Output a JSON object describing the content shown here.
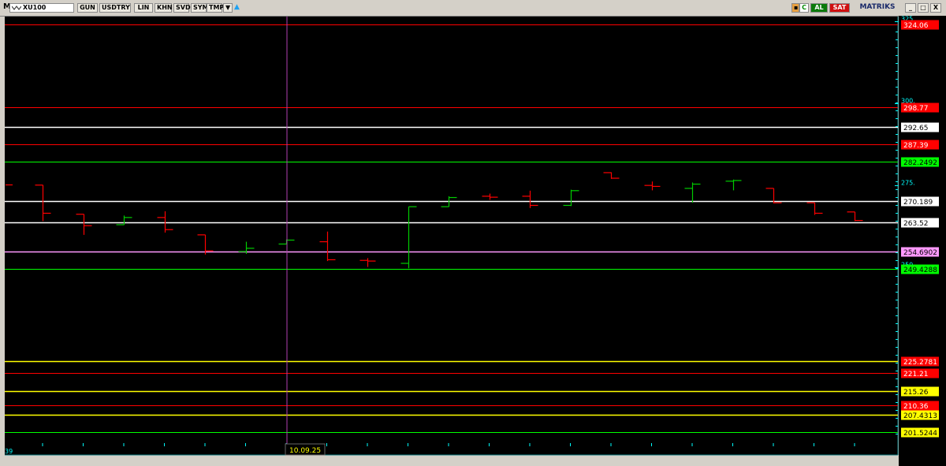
{
  "toolbar": {
    "app_icon": "M",
    "symbol": "XU100",
    "buttons": [
      "GUN",
      "USDTRY",
      "LIN",
      "KHN",
      "SVD",
      "SYM",
      "TMP"
    ],
    "dropdown_icon": "▼",
    "twitter_icon": "twitter-bird-icon",
    "tool_c": "C",
    "al_label": "AL",
    "sat_label": "SAT",
    "brand": "MATRIKS",
    "min": "_",
    "max": "□",
    "close": "X"
  },
  "colors": {
    "background": "#000000",
    "up": "#00cc00",
    "down": "#ff0000",
    "white_line": "#ffffff",
    "pink_line": "#ff99ff",
    "yellow_line": "#ffff00",
    "axis_text": "#00ffff"
  },
  "chart_data": {
    "type": "ohlc",
    "instrument": "XU100",
    "x_label_start": "39",
    "crosshair_date": "10.09.25",
    "ylim_display": [
      200,
      326
    ],
    "break_between": [
      227,
      247
    ],
    "axis_ticks": [
      "325.",
      "300.",
      "275.",
      "250"
    ],
    "horizontal_levels": [
      {
        "label": "324.06",
        "value": 324.06,
        "color": "#ff0000",
        "tag_bg": "#ff0000",
        "tag_fg": "#ffffff"
      },
      {
        "label": "298.77",
        "value": 298.77,
        "color": "#ff0000",
        "tag_bg": "#ff0000",
        "tag_fg": "#ffffff"
      },
      {
        "label": "292.65",
        "value": 292.65,
        "color": "#ffffff",
        "tag_bg": "#ffffff",
        "tag_fg": "#000000"
      },
      {
        "label": "287.39",
        "value": 287.39,
        "color": "#ff0000",
        "tag_bg": "#ff0000",
        "tag_fg": "#ffffff"
      },
      {
        "label": "282.2492",
        "value": 282.2492,
        "color": "#00ff00",
        "tag_bg": "#00ff00",
        "tag_fg": "#000000"
      },
      {
        "label": "270.189",
        "value": 270.189,
        "color": "#ffffff",
        "tag_bg": "#ffffff",
        "tag_fg": "#000000"
      },
      {
        "label": "263.52",
        "value": 263.52,
        "color": "#ffffff",
        "tag_bg": "#ffffff",
        "tag_fg": "#000000"
      },
      {
        "label": "254.6902",
        "value": 254.6902,
        "color": "#ff99ff",
        "tag_bg": "#ff99ff",
        "tag_fg": "#000000"
      },
      {
        "label": "249.4288",
        "value": 249.4288,
        "color": "#00ff00",
        "tag_bg": "#00ff00",
        "tag_fg": "#000000"
      },
      {
        "label": "225.2781",
        "value": 225.2781,
        "color": "#ffff00",
        "tag_bg": "#ff0000",
        "tag_fg": "#ffffff"
      },
      {
        "label": "221.21",
        "value": 221.21,
        "color": "#ff0000",
        "tag_bg": "#ff0000",
        "tag_fg": "#ffffff"
      },
      {
        "label": "215.26",
        "value": 215.26,
        "color": "#ffff00",
        "tag_bg": "#ffff00",
        "tag_fg": "#000000"
      },
      {
        "label": "210.36",
        "value": 210.36,
        "color": "#ff0000",
        "tag_bg": "#ff0000",
        "tag_fg": "#ffffff"
      },
      {
        "label": "207.4313",
        "value": 207.4313,
        "color": "#ffff00",
        "tag_bg": "#ffff00",
        "tag_fg": "#000000"
      },
      {
        "label": "201.5244",
        "value": 201.5244,
        "color": "#00ff00",
        "tag_bg": "#ffff00",
        "tag_fg": "#000000"
      }
    ],
    "bars": [
      {
        "o": 275.0,
        "h": 275.0,
        "l": 264.0,
        "c": 266.4,
        "dir": "down"
      },
      {
        "o": 266.1,
        "h": 266.1,
        "l": 259.8,
        "c": 262.6,
        "dir": "down"
      },
      {
        "o": 262.9,
        "h": 265.7,
        "l": 262.9,
        "c": 265.1,
        "dir": "up"
      },
      {
        "o": 265.1,
        "h": 267.0,
        "l": 260.5,
        "c": 261.4,
        "dir": "down"
      },
      {
        "o": 259.8,
        "h": 259.8,
        "l": 253.8,
        "c": 254.9,
        "dir": "down"
      },
      {
        "o": 254.7,
        "h": 257.7,
        "l": 254.0,
        "c": 255.7,
        "dir": "up"
      },
      {
        "o": 257.0,
        "h": 258.4,
        "l": 257.0,
        "c": 258.2,
        "dir": "up"
      },
      {
        "o": 257.7,
        "h": 260.8,
        "l": 251.8,
        "c": 252.2,
        "dir": "down"
      },
      {
        "o": 252.0,
        "h": 252.7,
        "l": 250.0,
        "c": 251.8,
        "dir": "down"
      },
      {
        "o": 251.1,
        "h": 268.4,
        "l": 249.6,
        "c": 268.4,
        "dir": "up"
      },
      {
        "o": 268.4,
        "h": 271.6,
        "l": 268.4,
        "c": 271.2,
        "dir": "up"
      },
      {
        "o": 271.6,
        "h": 272.4,
        "l": 270.5,
        "c": 271.3,
        "dir": "down"
      },
      {
        "o": 271.6,
        "h": 273.3,
        "l": 268.0,
        "c": 268.8,
        "dir": "down"
      },
      {
        "o": 268.8,
        "h": 273.6,
        "l": 268.6,
        "c": 273.3,
        "dir": "up"
      },
      {
        "o": 278.8,
        "h": 278.9,
        "l": 276.9,
        "c": 277.1,
        "dir": "down"
      },
      {
        "o": 274.9,
        "h": 276.1,
        "l": 273.4,
        "c": 274.6,
        "dir": "down"
      },
      {
        "o": 274.0,
        "h": 275.8,
        "l": 269.6,
        "c": 275.3,
        "dir": "up"
      },
      {
        "o": 276.2,
        "h": 276.7,
        "l": 273.4,
        "c": 276.4,
        "dir": "up"
      },
      {
        "o": 274.0,
        "h": 274.0,
        "l": 269.4,
        "c": 269.6,
        "dir": "down"
      },
      {
        "o": 269.6,
        "h": 269.6,
        "l": 265.9,
        "c": 266.4,
        "dir": "down"
      },
      {
        "o": 266.8,
        "h": 266.8,
        "l": 264.0,
        "c": 264.2,
        "dir": "down"
      }
    ]
  }
}
